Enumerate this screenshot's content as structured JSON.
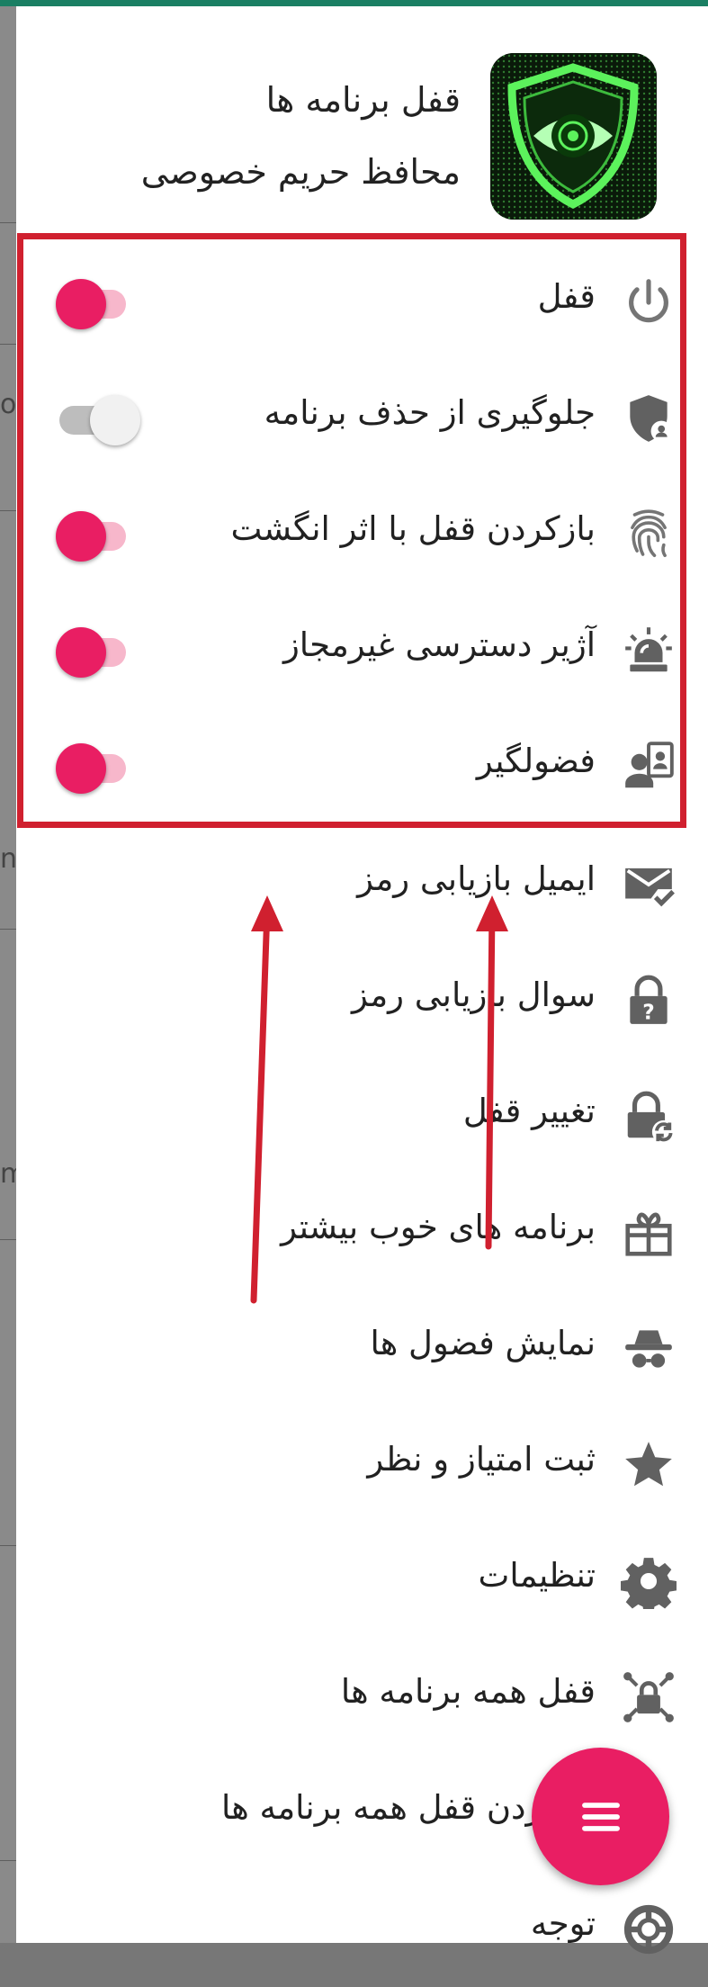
{
  "colors": {
    "accent": "#e91e63",
    "status_bar": "#1a7f63",
    "annotation_red": "#d0202f",
    "icon_gray": "#757575"
  },
  "header": {
    "title": "قفل برنامه ها",
    "subtitle": "محافظ حریم خصوصی",
    "logo_icon": "eye-shield-logo"
  },
  "toggle_items": [
    {
      "label": "قفل",
      "icon": "power-icon",
      "enabled": true
    },
    {
      "label": "جلوگیری از حذف برنامه",
      "icon": "shield-user-icon",
      "enabled": false
    },
    {
      "label": "بازکردن قفل با اثر انگشت",
      "icon": "fingerprint-icon",
      "enabled": true
    },
    {
      "label": "آژیر دسترسی غیرمجاز",
      "icon": "alarm-siren-icon",
      "enabled": true
    },
    {
      "label": "فضولگیر",
      "icon": "intruder-icon",
      "enabled": true
    }
  ],
  "menu_items": [
    {
      "label": "ایمیل بازیابی رمز",
      "icon": "email-check-icon"
    },
    {
      "label": "سوال بازیابی رمز",
      "icon": "lock-question-icon"
    },
    {
      "label": "تغییر قفل",
      "icon": "lock-refresh-icon"
    },
    {
      "label": "برنامه های خوب بیشتر",
      "icon": "gift-icon"
    },
    {
      "label": "نمایش فضول ها",
      "icon": "spy-icon"
    },
    {
      "label": "ثبت امتیاز و نظر",
      "icon": "star-icon"
    },
    {
      "label": "تنظیمات",
      "icon": "gear-icon"
    },
    {
      "label": "قفل همه برنامه ها",
      "icon": "lock-all-icon"
    },
    {
      "label": "بازکردن قفل همه برنامه ها",
      "icon": "unlock-all-icon"
    },
    {
      "label": "توجه",
      "icon": "lifebuoy-icon"
    }
  ],
  "fab": {
    "icon": "menu-icon"
  }
}
